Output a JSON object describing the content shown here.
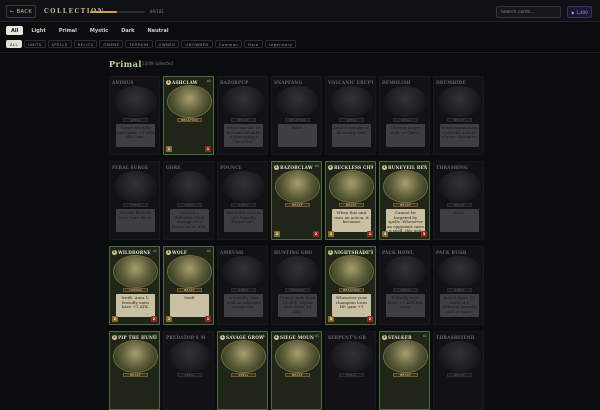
{
  "header": {
    "back_label": "← BACK",
    "title": "COLLECTION",
    "progress_text": "89/181",
    "progress_fraction": 0.49,
    "search_placeholder": "Search cards...",
    "user_label": "1,400"
  },
  "filters": {
    "primary": [
      {
        "label": "All",
        "active": true
      },
      {
        "label": "Light",
        "active": false
      },
      {
        "label": "Primal",
        "active": false
      },
      {
        "label": "Mystic",
        "active": false
      },
      {
        "label": "Dark",
        "active": false
      },
      {
        "label": "Neutral",
        "active": false
      }
    ],
    "secondary": [
      {
        "label": "ALL",
        "active": true
      },
      {
        "label": "UNITS",
        "active": false
      },
      {
        "label": "SPELLS",
        "active": false
      },
      {
        "label": "RELICS",
        "active": false
      },
      {
        "label": "OMENS",
        "active": false
      },
      {
        "label": "TERRAIN",
        "active": false
      },
      {
        "label": "OWNED",
        "active": false
      },
      {
        "label": "UNOWNED",
        "active": false
      },
      {
        "label": "Common",
        "active": false
      },
      {
        "label": "Rare",
        "active": false
      },
      {
        "label": "Legendary",
        "active": false
      }
    ]
  },
  "section": {
    "faction": "Primal",
    "collected_text": "13/49 collected"
  },
  "cards": [
    {
      "name": "ANIMUS",
      "cost": "",
      "qty": "",
      "type": "SPELL",
      "text": "Target friendly unit gains +1 ATK this turn.",
      "atk": "",
      "hp": "",
      "owned": false
    },
    {
      "name": "ASHCLAW",
      "cost": "1",
      "qty": "x1",
      "type": "BEASTKIN",
      "text": "",
      "atk": "1",
      "hp": "1",
      "owned": true
    },
    {
      "name": "RAZORPUP",
      "cost": "",
      "qty": "",
      "type": "BEAST",
      "text": "Write one tile of fuel and all units is damaging a character.",
      "atk": "",
      "hp": "",
      "owned": false
    },
    {
      "name": "SNAPFANG",
      "cost": "",
      "qty": "",
      "type": "BEASTKIN",
      "text": "Rush.",
      "atk": "",
      "hp": "",
      "owned": false
    },
    {
      "name": "VOLCANIC ERUPT",
      "cost": "",
      "qty": "",
      "type": "SPELL",
      "text": "Deal 3 damage to an enemy unit.",
      "atk": "",
      "hp": "",
      "owned": false
    },
    {
      "name": "DEMOLISH",
      "cost": "",
      "qty": "",
      "type": "SPELL",
      "text": "Destroy target Relic or Omen.",
      "atk": "",
      "hp": "",
      "owned": false
    },
    {
      "name": "DRUMHIDE",
      "cost": "",
      "qty": "",
      "type": "BEAST",
      "text": "When summoned, roots the actions of your champion.",
      "atk": "",
      "hp": "",
      "owned": false
    },
    {
      "name": "FERAL SURGE",
      "cost": "",
      "qty": "",
      "type": "SPELL",
      "text": "Nearby friendly units have Rush.",
      "atk": "",
      "hp": "",
      "owned": false
    },
    {
      "name": "GORE",
      "cost": "",
      "qty": "",
      "type": "SPELL",
      "text": "Choose a defender. Deal damage to it based on its ATK.",
      "atk": "",
      "hp": "",
      "owned": false
    },
    {
      "name": "POUNCE",
      "cost": "",
      "qty": "",
      "type": "SPELL",
      "text": "Reset the actions of a friendly Primal unit.",
      "atk": "",
      "hp": "",
      "owned": false
    },
    {
      "name": "RAZORCLAW",
      "cost": "2",
      "qty": "x1",
      "type": "BEAST",
      "text": "",
      "atk": "2",
      "hp": "2",
      "owned": true
    },
    {
      "name": "RECKLESS CHARG",
      "cost": "2",
      "qty": "x1",
      "type": "BEAST",
      "text": "When this unit uses an action, it becomes",
      "atk": "2",
      "hp": "1",
      "owned": true
    },
    {
      "name": "RUNEVEIL BEA",
      "cost": "3",
      "qty": "x1",
      "type": "BEAST",
      "text": "Cannot be targeted by spells. Whenever an opponent casts a spell, this unit permanently gains +1/+1.",
      "atk": "3",
      "hp": "3",
      "owned": true
    },
    {
      "name": "THRASHING",
      "cost": "",
      "qty": "",
      "type": "BEAST",
      "text": "Rush.",
      "atk": "",
      "hp": "",
      "owned": false
    },
    {
      "name": "WILDBORNE",
      "cost": "2",
      "qty": "x1",
      "type": "HUMAN",
      "text": "Swift. Aura 1: friendly units have +1 ATK.",
      "atk": "2",
      "hp": "2",
      "owned": true
    },
    {
      "name": "WOLF",
      "cost": "1",
      "qty": "x1",
      "type": "BEAST",
      "text": "Swift",
      "atk": "1",
      "hp": "1",
      "owned": true
    },
    {
      "name": "AMBUSH",
      "cost": "",
      "qty": "",
      "type": "SPELL",
      "text": "A friendly unit with an adjacent enemy unit.",
      "atk": "",
      "hp": "",
      "owned": false
    },
    {
      "name": "HUNTING GRO",
      "cost": "",
      "qty": "",
      "type": "TERRAIN",
      "text": "Primal units have +1 ATK. Mystic units have +1 ATK.",
      "atk": "",
      "hp": "",
      "owned": false
    },
    {
      "name": "NIGHTSHADE REA",
      "cost": "3",
      "qty": "x1",
      "type": "BEASTKIN",
      "text": "Whenever your champion loses HP, gain +1",
      "atk": "3",
      "hp": "2",
      "owned": true
    },
    {
      "name": "PACK HOWL",
      "cost": "",
      "qty": "",
      "type": "SPELL",
      "text": "Friendly units have +1 ATK this turn.",
      "atk": "",
      "hp": "",
      "owned": false
    },
    {
      "name": "PACK RUSH",
      "cost": "",
      "qty": "",
      "type": "SPELL",
      "text": "Select three (3) units of a different friendly unit or more.",
      "atk": "",
      "hp": "",
      "owned": false
    },
    {
      "name": "PIP THE HUNGE",
      "cost": "2",
      "qty": "x1",
      "type": "BEAST",
      "text": "",
      "atk": "",
      "hp": "",
      "owned": true
    },
    {
      "name": "PREDATOR'S M",
      "cost": "",
      "qty": "",
      "type": "SPELL",
      "text": "",
      "atk": "",
      "hp": "",
      "owned": false
    },
    {
      "name": "SAVAGE GROW",
      "cost": "1",
      "qty": "x1",
      "type": "SPELL",
      "text": "",
      "atk": "",
      "hp": "",
      "owned": true
    },
    {
      "name": "SIEGE MOUN",
      "cost": "4",
      "qty": "x1",
      "type": "BEAST",
      "text": "",
      "atk": "",
      "hp": "",
      "owned": true
    },
    {
      "name": "SERPENT'S GR",
      "cost": "",
      "qty": "",
      "type": "SPELL",
      "text": "",
      "atk": "",
      "hp": "",
      "owned": false
    },
    {
      "name": "STALKER",
      "cost": "3",
      "qty": "x1",
      "type": "BEAST",
      "text": "",
      "atk": "",
      "hp": "",
      "owned": true
    },
    {
      "name": "THRASHFIEND",
      "cost": "",
      "qty": "",
      "type": "BEAST",
      "text": "",
      "atk": "",
      "hp": "",
      "owned": false
    }
  ]
}
